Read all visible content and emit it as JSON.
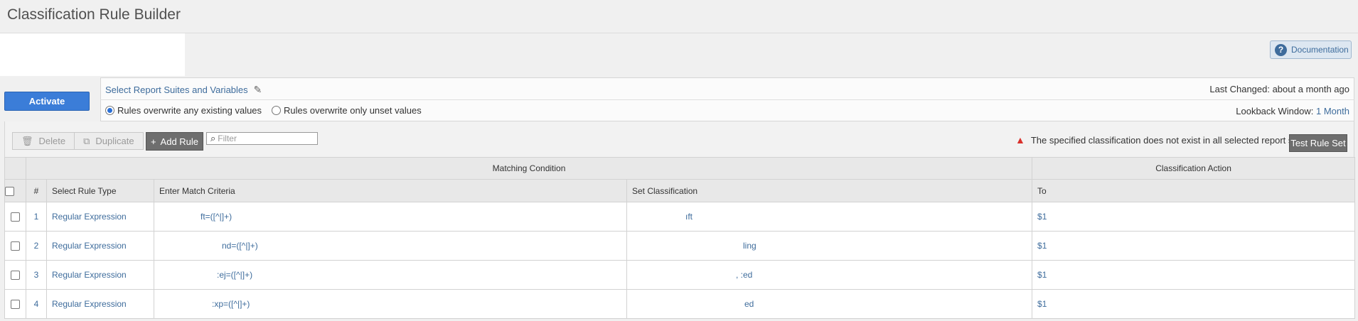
{
  "page": {
    "title": "Classification Rule Builder"
  },
  "header": {
    "documentation_label": "Documentation",
    "help_icon": "?"
  },
  "actions": {
    "activate_label": "Activate"
  },
  "settings": {
    "report_suites_link": "Select Report Suites and Variables",
    "last_changed": "Last Changed: about a month ago",
    "radio_overwrite_any": "Rules overwrite any existing values",
    "radio_overwrite_unset": "Rules overwrite only unset values",
    "selected_radio": "Rules overwrite any existing values",
    "lookback_label": "Lookback Window:",
    "lookback_value": "1 Month"
  },
  "toolbar": {
    "delete_label": "Delete",
    "duplicate_label": "Duplicate",
    "add_rule_label": "Add Rule",
    "filter_placeholder": "Filter",
    "warning_text": "The specified classification does not exist in all selected report suites",
    "test_rule_set_label": "Test Rule Set"
  },
  "table": {
    "group_headers": {
      "matching_condition": "Matching Condition",
      "classification_action": "Classification Action"
    },
    "columns": {
      "num": "#",
      "rule_type": "Select Rule Type",
      "criteria": "Enter Match Criteria",
      "set_classification": "Set Classification",
      "to": "To"
    },
    "rows": [
      {
        "num": "1",
        "rule_type": "Regular Expression",
        "criteria": "ft=([^|]+)",
        "classification": "ıft",
        "to": "$1"
      },
      {
        "num": "2",
        "rule_type": "Regular Expression",
        "criteria": "nd=([^|]+)",
        "classification": "ling",
        "to": "$1"
      },
      {
        "num": "3",
        "rule_type": "Regular Expression",
        "criteria": ":ej=([^|]+)",
        "classification": ", :ed",
        "to": "$1"
      },
      {
        "num": "4",
        "rule_type": "Regular Expression",
        "criteria": ":xp=([^|]+)",
        "classification": "ed",
        "to": "$1"
      }
    ]
  },
  "colors": {
    "accent": "#3b7dd8",
    "link": "#3e6c9c",
    "warning": "#d9302b",
    "dark_button": "#6e6e6e"
  }
}
